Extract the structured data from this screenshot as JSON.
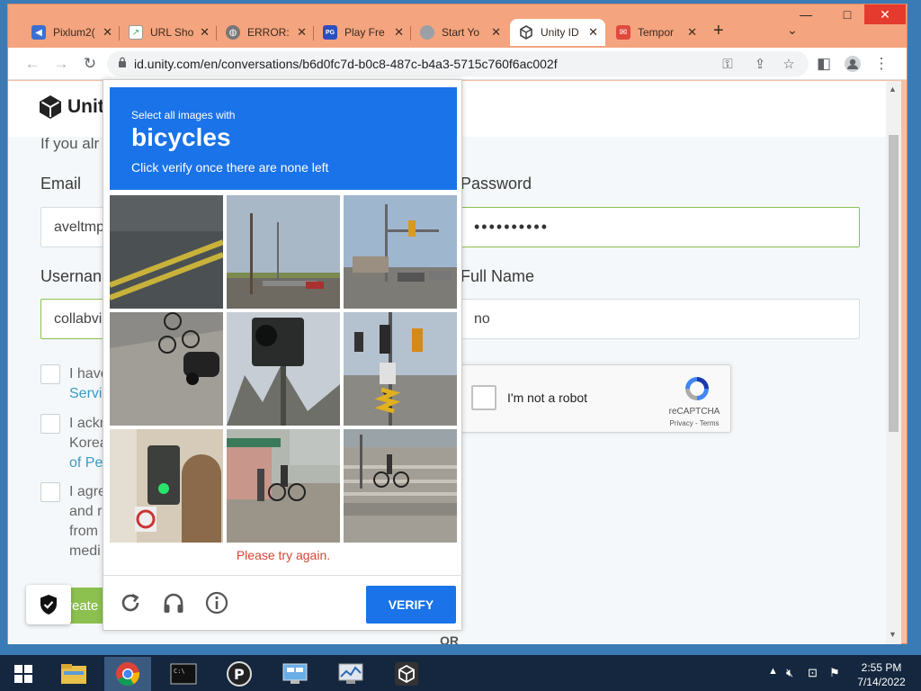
{
  "tabs": [
    {
      "title": "Pixlum2(",
      "icon": "pixlum-icon",
      "color": "#3b6fd1"
    },
    {
      "title": "URL Sho",
      "icon": "url-shortener-icon",
      "color": "#ffffff"
    },
    {
      "title": "ERROR:",
      "icon": "globe-icon",
      "color": "#777777"
    },
    {
      "title": "Play Fre",
      "icon": "play-free-icon",
      "color": "#2a4fbf"
    },
    {
      "title": "Start Yo",
      "icon": "start-icon",
      "color": "#9aa0a6"
    },
    {
      "title": "Unity ID",
      "icon": "unity-icon",
      "color": "#222222",
      "active": true
    },
    {
      "title": "Tempor",
      "icon": "mail-icon",
      "color": "#e04a3c"
    }
  ],
  "url": "id.unity.com/en/conversations/b6d0fc7d-b0c8-487c-b4a3-5715c760f6ac002f",
  "page": {
    "logo_text": "Unit",
    "if_you": "If you alr",
    "email_label": "Email",
    "email_value": "aveltmp",
    "password_label": "Password",
    "password_value": "••••••••••",
    "username_label": "Usernan",
    "username_value": "collabvi",
    "fullname_label": "Full Name",
    "fullname_value": "no",
    "cb1_line1": "I have",
    "cb1_line2": "Servi",
    "cb2_line1": "I ackn",
    "cb2_line2": "Korea",
    "cb2_line3": "of Pe",
    "cb3_line1": "I agre",
    "cb3_line2": "and r",
    "cb3_line3": "from",
    "cb3_line4": "medi",
    "create_label": "reate",
    "or_label": "OR",
    "recaptcha_text": "I'm not a robot",
    "recaptcha_brand": "reCAPTCHA",
    "recaptcha_terms": "Privacy - Terms"
  },
  "captcha": {
    "line1": "Select all images with",
    "target": "bicycles",
    "line3": "Click verify once there are none left",
    "error": "Please try again.",
    "verify_label": "VERIFY"
  },
  "clock": {
    "time": "2:55 PM",
    "date": "7/14/2022"
  },
  "colors": {
    "accent": "#1a73e8",
    "unity_green": "#8cc04f",
    "error": "#d14836"
  }
}
